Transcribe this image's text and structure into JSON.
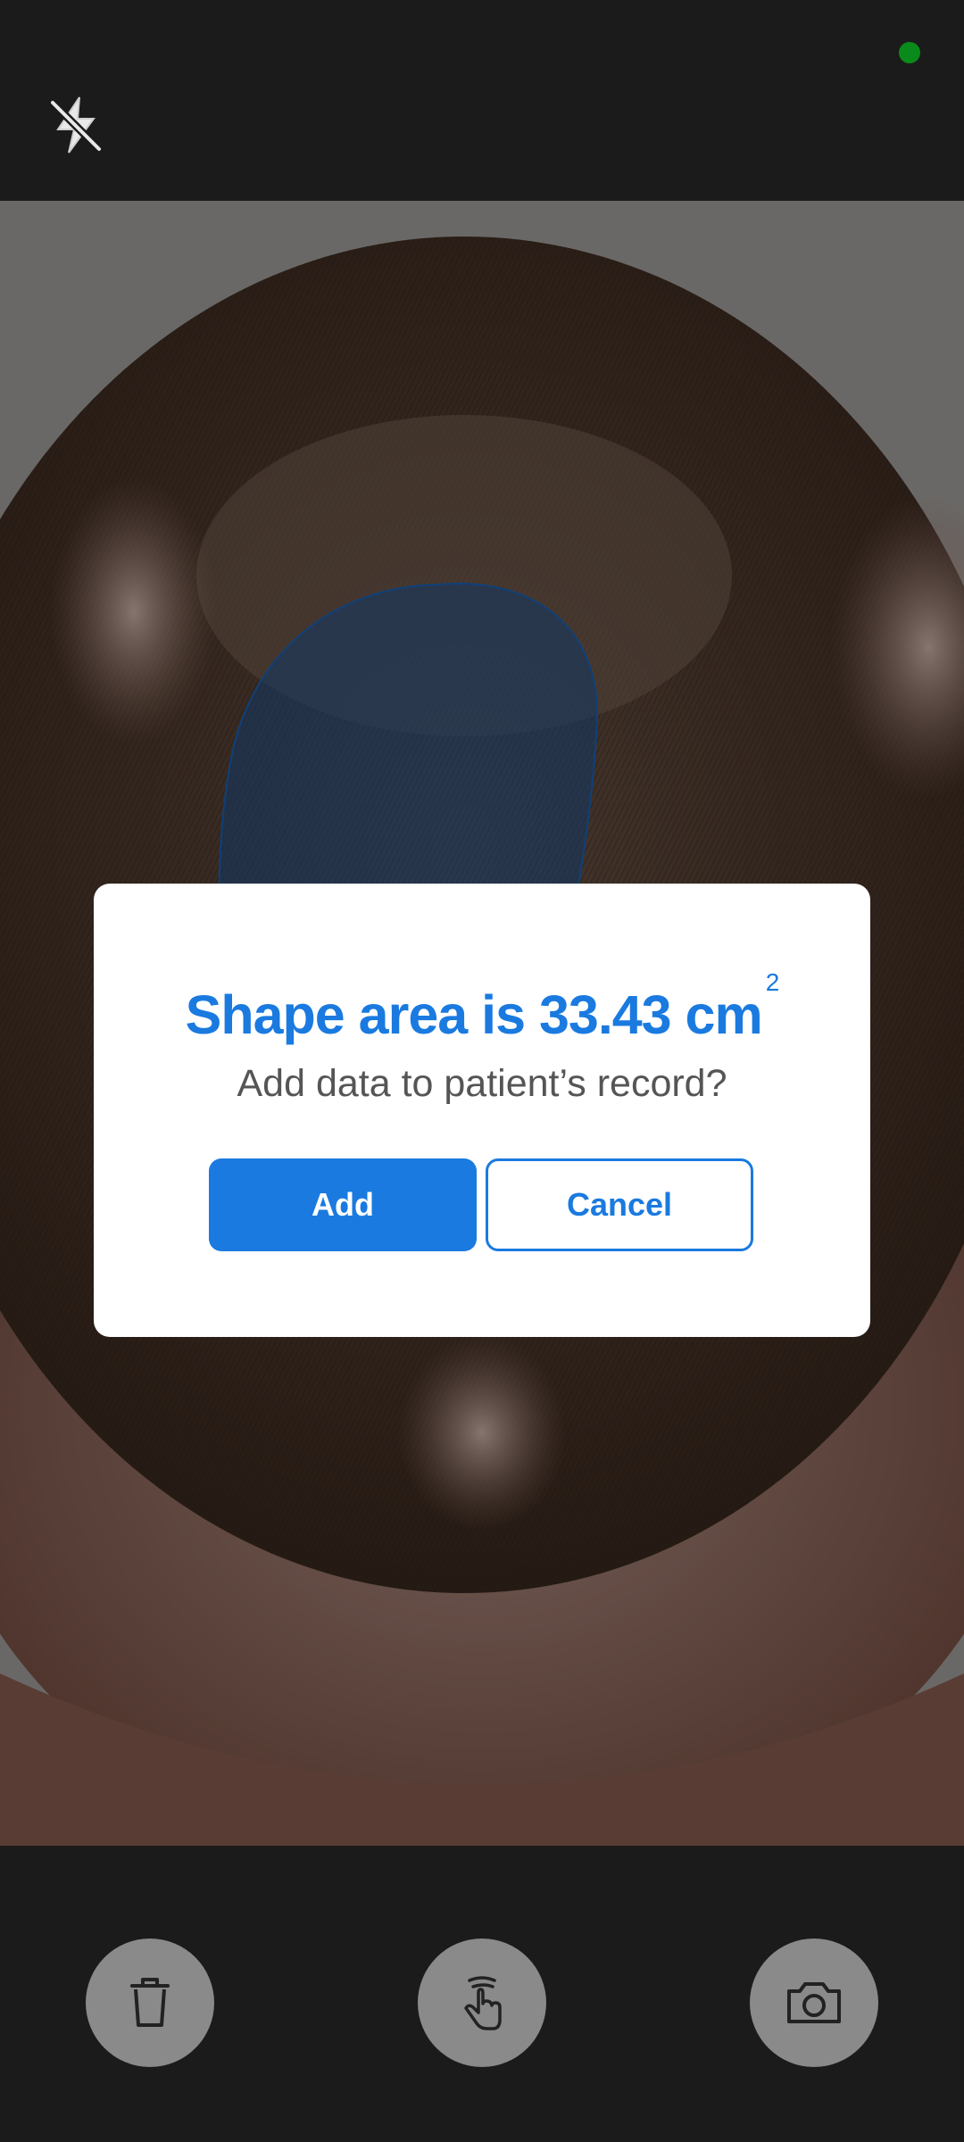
{
  "colors": {
    "accent": "#1a7ae0",
    "status_dot": "#0a8a1a",
    "shape_overlay": "#1f5fae"
  },
  "top_bar": {
    "flash_icon": "flash-off-icon",
    "status_indicator": "green-dot"
  },
  "dialog": {
    "title": "Shape area is 33.43 cm",
    "title_superscript": "2",
    "subtitle": "Add data to patient’s record?",
    "add_label": "Add",
    "cancel_label": "Cancel"
  },
  "toolbar": {
    "items": [
      {
        "icon": "trash-icon"
      },
      {
        "icon": "hand-gesture-icon"
      },
      {
        "icon": "camera-icon"
      }
    ]
  }
}
